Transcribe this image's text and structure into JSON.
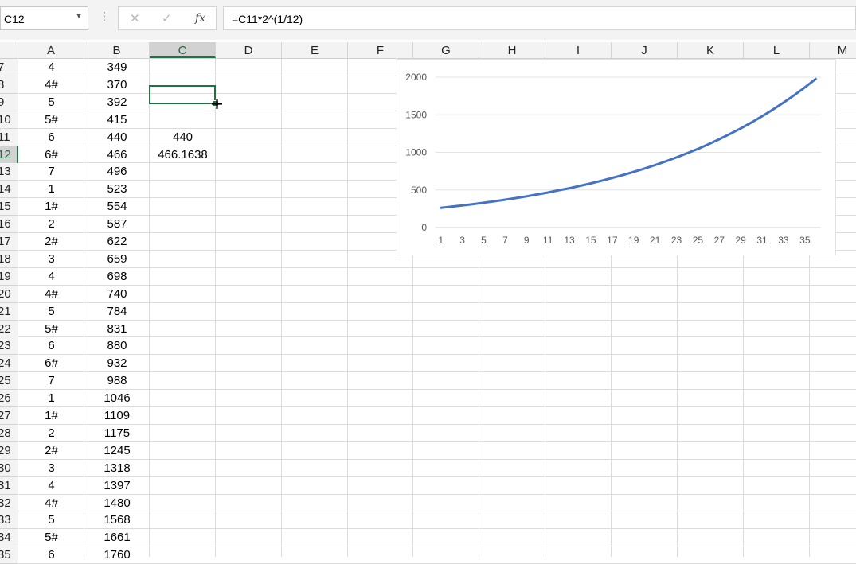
{
  "name_box": {
    "value": "C12"
  },
  "formula_bar": {
    "formula": "=C11*2^(1/12)",
    "cancel_icon": "✕",
    "enter_icon": "✓",
    "fx_label": "fx"
  },
  "columns": [
    {
      "label": ""
    },
    {
      "label": "A"
    },
    {
      "label": "B"
    },
    {
      "label": "C"
    },
    {
      "label": "D"
    },
    {
      "label": "E"
    },
    {
      "label": "F"
    },
    {
      "label": "G"
    },
    {
      "label": "H"
    },
    {
      "label": "I"
    },
    {
      "label": "J"
    },
    {
      "label": "K"
    },
    {
      "label": "L"
    },
    {
      "label": "M"
    }
  ],
  "rows": [
    {
      "num": "7",
      "a": "4",
      "b": "349",
      "c": ""
    },
    {
      "num": "8",
      "a": "4#",
      "b": "370",
      "c": ""
    },
    {
      "num": "9",
      "a": "5",
      "b": "392",
      "c": ""
    },
    {
      "num": "10",
      "a": "5#",
      "b": "415",
      "c": ""
    },
    {
      "num": "11",
      "a": "6",
      "b": "440",
      "c": "440"
    },
    {
      "num": "12",
      "a": "6#",
      "b": "466",
      "c": "466.1638"
    },
    {
      "num": "13",
      "a": "7",
      "b": "496",
      "c": ""
    },
    {
      "num": "14",
      "a": "1",
      "b": "523",
      "c": ""
    },
    {
      "num": "15",
      "a": "1#",
      "b": "554",
      "c": ""
    },
    {
      "num": "16",
      "a": "2",
      "b": "587",
      "c": ""
    },
    {
      "num": "17",
      "a": "2#",
      "b": "622",
      "c": ""
    },
    {
      "num": "18",
      "a": "3",
      "b": "659",
      "c": ""
    },
    {
      "num": "19",
      "a": "4",
      "b": "698",
      "c": ""
    },
    {
      "num": "20",
      "a": "4#",
      "b": "740",
      "c": ""
    },
    {
      "num": "21",
      "a": "5",
      "b": "784",
      "c": ""
    },
    {
      "num": "22",
      "a": "5#",
      "b": "831",
      "c": ""
    },
    {
      "num": "23",
      "a": "6",
      "b": "880",
      "c": ""
    },
    {
      "num": "24",
      "a": "6#",
      "b": "932",
      "c": ""
    },
    {
      "num": "25",
      "a": "7",
      "b": "988",
      "c": ""
    },
    {
      "num": "26",
      "a": "1",
      "b": "1046",
      "c": ""
    },
    {
      "num": "27",
      "a": "1#",
      "b": "1109",
      "c": ""
    },
    {
      "num": "28",
      "a": "2",
      "b": "1175",
      "c": ""
    },
    {
      "num": "29",
      "a": "2#",
      "b": "1245",
      "c": ""
    },
    {
      "num": "30",
      "a": "3",
      "b": "1318",
      "c": ""
    },
    {
      "num": "31",
      "a": "4",
      "b": "1397",
      "c": ""
    },
    {
      "num": "32",
      "a": "4#",
      "b": "1480",
      "c": ""
    },
    {
      "num": "33",
      "a": "5",
      "b": "1568",
      "c": ""
    },
    {
      "num": "34",
      "a": "5#",
      "b": "1661",
      "c": ""
    },
    {
      "num": "35",
      "a": "6",
      "b": "1760",
      "c": ""
    }
  ],
  "colors": {
    "selection": "#217346",
    "series": "#4472c4",
    "header_bg": "#f3f3f3"
  },
  "chart_data": {
    "type": "line",
    "title": "",
    "xlabel": "",
    "ylabel": "",
    "ylim": [
      0,
      2000
    ],
    "yticks": [
      "0",
      "500",
      "1000",
      "1500",
      "2000"
    ],
    "xticks": [
      "1",
      "3",
      "5",
      "7",
      "9",
      "11",
      "13",
      "15",
      "17",
      "19",
      "21",
      "23",
      "25",
      "27",
      "29",
      "31",
      "33",
      "35"
    ],
    "grid": true,
    "legend": "none",
    "x": [
      1,
      2,
      3,
      4,
      5,
      6,
      7,
      8,
      9,
      10,
      11,
      12,
      13,
      14,
      15,
      16,
      17,
      18,
      19,
      20,
      21,
      22,
      23,
      24,
      25,
      26,
      27,
      28,
      29,
      30,
      31,
      32,
      33,
      34,
      35,
      36
    ],
    "series": [
      {
        "values": [
          262,
          277,
          294,
          311,
          330,
          349,
          370,
          392,
          415,
          440,
          466,
          496,
          523,
          554,
          587,
          622,
          659,
          698,
          740,
          784,
          831,
          880,
          932,
          988,
          1046,
          1109,
          1175,
          1245,
          1318,
          1397,
          1480,
          1568,
          1661,
          1760,
          1865,
          1976
        ]
      }
    ]
  }
}
